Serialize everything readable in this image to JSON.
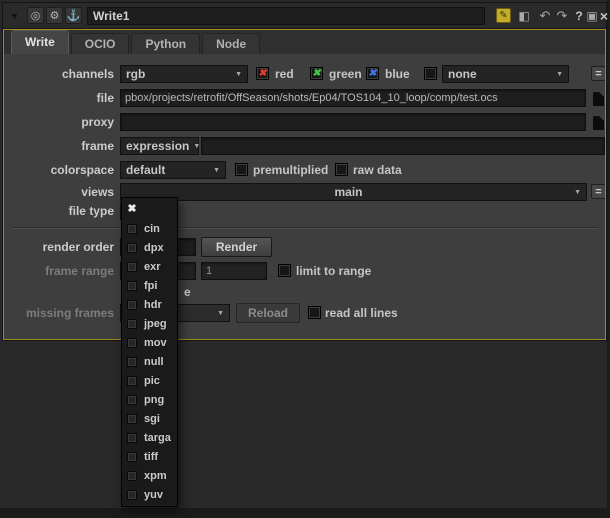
{
  "titlebar": {
    "title": "Write1",
    "icons": {
      "panel_menu": "▼",
      "center_node": "◎",
      "gear": "⚙",
      "anchor": "⚓",
      "edit": "✎",
      "split_view": "◧",
      "undo": "↶",
      "redo": "↷",
      "help": "?",
      "float_panel": "▣",
      "close": "×"
    }
  },
  "tabs": {
    "write": "Write",
    "ocio": "OCIO",
    "python": "Python",
    "node": "Node"
  },
  "ui": {
    "dropdown_arrow": "▼",
    "check_mark": "✖",
    "selected_mark": "✖"
  },
  "form": {
    "channels": {
      "label": "channels",
      "layer_set": "rgb",
      "red": "red",
      "green": "green",
      "blue": "blue",
      "mask": "none",
      "equals": "="
    },
    "file": {
      "label": "file",
      "path": "pbox/projects/retrofit/OffSeason/shots/Ep04/TOS104_10_loop/comp/test.ocs"
    },
    "proxy": {
      "label": "proxy"
    },
    "frame": {
      "label": "frame",
      "mode": "expression"
    },
    "colorspace": {
      "label": "colorspace",
      "value": "default",
      "premultiplied": "premultiplied",
      "raw_data": "raw data"
    },
    "views": {
      "label": "views",
      "value": "main",
      "equals": "="
    },
    "file_type": {
      "label": "file type"
    },
    "render_order": {
      "label": "render order",
      "render": "Render"
    },
    "frame_range": {
      "label": "frame range",
      "last": "1",
      "limit": "limit to range"
    },
    "obscured_fragment": "e",
    "missing_frames": {
      "label": "missing frames",
      "reload": "Reload",
      "read_all_lines": "read all lines"
    }
  },
  "file_type_menu": {
    "items": [
      "",
      "cin",
      "dpx",
      "exr",
      "fpi",
      "hdr",
      "jpeg",
      "mov",
      "null",
      "pic",
      "png",
      "sgi",
      "targa",
      "tiff",
      "xpm",
      "yuv"
    ]
  },
  "colors": {
    "focus_border": "#a28c1e",
    "red_check": "#df3b2f",
    "green_check": "#44c544",
    "blue_check": "#4272de",
    "edit_icon_bg": "#c3ad28"
  }
}
